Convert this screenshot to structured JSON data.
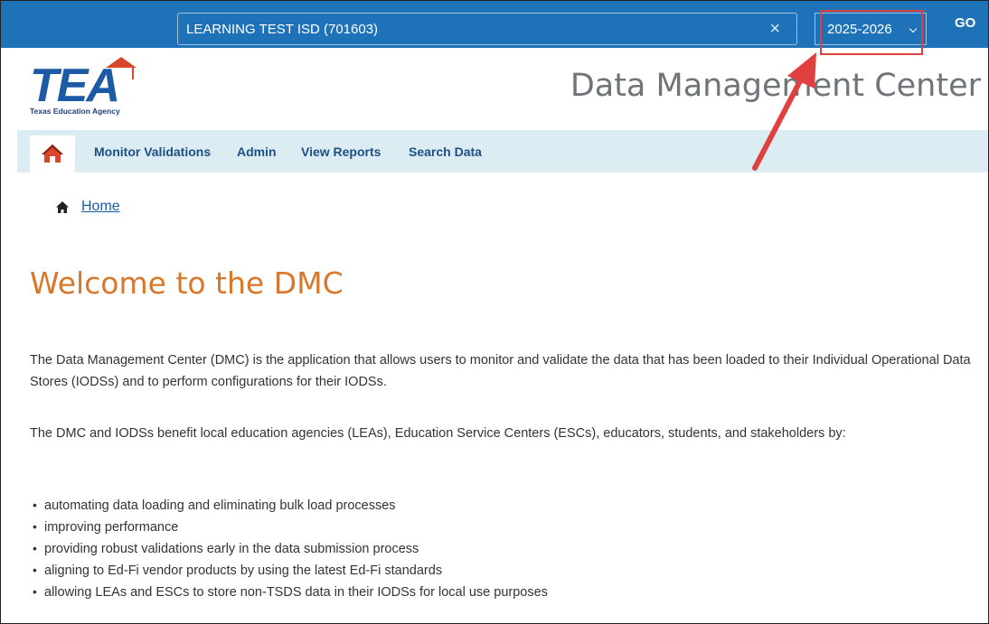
{
  "topbar": {
    "organization_value": "LEARNING TEST ISD (701603)",
    "clear_symbol": "×",
    "year_value": "2025-2026",
    "go_label": "GO",
    "background_color": "#1d72b8"
  },
  "header": {
    "logo_text": "TEA",
    "logo_subtitle": "Texas Education Agency",
    "site_title": "Data Management Center"
  },
  "nav": {
    "home_icon": "home-icon",
    "items": [
      {
        "label": "Monitor Validations"
      },
      {
        "label": "Admin"
      },
      {
        "label": "View Reports"
      },
      {
        "label": "Search Data"
      }
    ]
  },
  "breadcrumb": {
    "home_label": "Home"
  },
  "content": {
    "heading": "Welcome to the DMC",
    "paragraph1": "The Data Management Center (DMC) is the application that allows users to monitor and validate the data that has been loaded to their Individual Operational Data Stores (IODSs) and to perform configurations for their IODSs.",
    "paragraph2": "The DMC and IODSs benefit local education agencies (LEAs), Education Service Centers (ESCs), educators, students, and stakeholders by:",
    "bullets": [
      "automating data loading and eliminating bulk load processes",
      "improving performance",
      "providing robust validations early in the data submission process",
      "aligning to Ed-Fi vendor products by using the latest Ed-Fi standards",
      "allowing LEAs and ESCs to store non-TSDS data in their IODSs for local use purposes"
    ]
  },
  "colors": {
    "heading": "#d9772b",
    "link": "#1a5aa8",
    "nav_bg": "#dbedf2",
    "annotation_red": "#e0403f"
  }
}
